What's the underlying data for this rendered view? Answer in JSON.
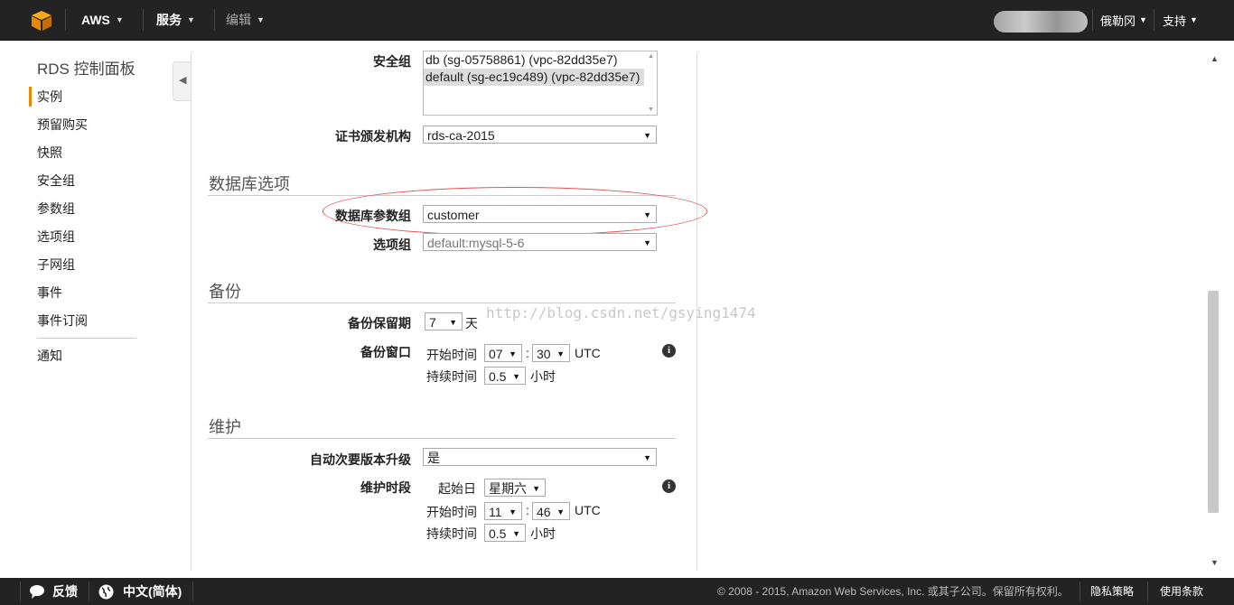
{
  "header": {
    "aws_label": "AWS",
    "services_label": "服务",
    "edit_label": "编辑",
    "region_label": "俄勒冈",
    "support_label": "支持"
  },
  "sidebar": {
    "title": "RDS 控制面板",
    "items": [
      "实例",
      "预留购买",
      "快照",
      "安全组",
      "参数组",
      "选项组",
      "子网组",
      "事件",
      "事件订阅"
    ],
    "extra_item": "通知",
    "active_index": 0
  },
  "form": {
    "security_group_label": "安全组",
    "security_group_options": [
      "db (sg-05758861) (vpc-82dd35e7)",
      "default (sg-ec19c489) (vpc-82dd35e7)"
    ],
    "cert_label": "证书颁发机构",
    "cert_value": "rds-ca-2015",
    "db_options_title": "数据库选项",
    "param_group_label": "数据库参数组",
    "param_group_value": "customer",
    "option_group_label": "选项组",
    "option_group_value": "default:mysql-5-6",
    "backup_title": "备份",
    "retention_label": "备份保留期",
    "retention_value": "7",
    "retention_unit": "天",
    "backup_window_label": "备份窗口",
    "start_time_label": "开始时间",
    "backup_hour": "07",
    "backup_minute": "30",
    "utc": "UTC",
    "colon": ":",
    "duration_label": "持续时间",
    "backup_duration": "0.5",
    "hours_unit": "小时",
    "maint_title": "维护",
    "auto_upgrade_label": "自动次要版本升级",
    "auto_upgrade_value": "是",
    "maint_window_label": "维护时段",
    "start_day_label": "起始日",
    "maint_day": "星期六",
    "maint_hour": "11",
    "maint_minute": "46",
    "maint_duration": "0.5"
  },
  "watermark": "http://blog.csdn.net/gsying1474",
  "footer": {
    "feedback_label": "反馈",
    "language_label": "中文(简体)",
    "copyright": "© 2008 - 2015, Amazon Web Services, Inc. 或其子公司。保留所有权利。",
    "privacy_label": "隐私策略",
    "terms_label": "使用条款"
  },
  "colors": {
    "accent": "#e88a00",
    "topbar": "#232323",
    "highlight_ellipse": "#e05555"
  }
}
